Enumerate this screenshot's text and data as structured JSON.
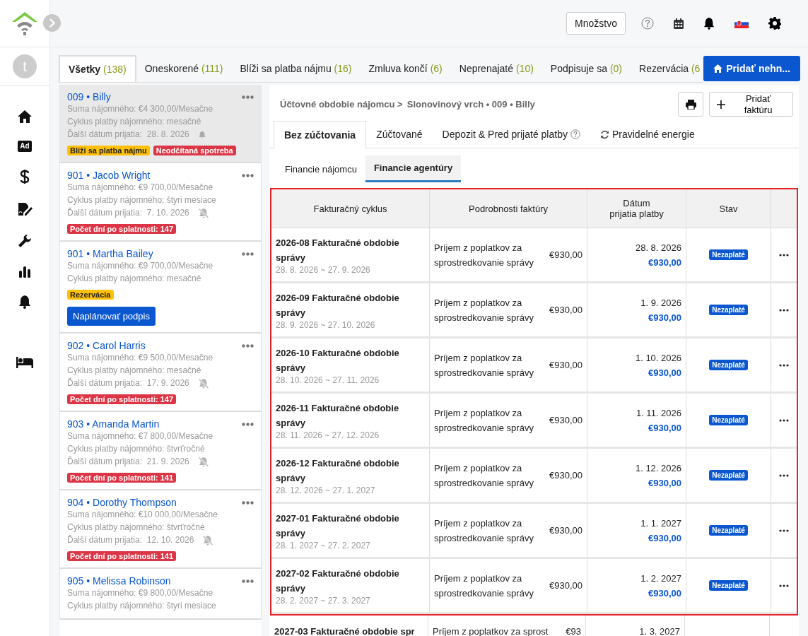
{
  "sidebar": {
    "avatar": "t",
    "nav": [
      {
        "kind": "home"
      },
      {
        "kind": "ad",
        "glyph": "Ad"
      },
      {
        "kind": "dollar"
      },
      {
        "kind": "sign"
      },
      {
        "kind": "wrench"
      },
      {
        "kind": "chart"
      },
      {
        "kind": "bell"
      },
      {
        "kind": "bed"
      }
    ]
  },
  "topbar": {
    "quantity_button": "Množstvo"
  },
  "tabs": [
    {
      "label": "Všetky",
      "count": "(138)",
      "selected": true
    },
    {
      "label": "Oneskorené",
      "count": "(111)",
      "selected": false
    },
    {
      "label": "Blíži sa platba nájmu",
      "count": "(16)",
      "selected": false
    },
    {
      "label": "Zmluva končí",
      "count": "(6)",
      "selected": false
    },
    {
      "label": "Neprenajaté",
      "count": "(10)",
      "selected": false
    },
    {
      "label": "Podpisuje sa",
      "count": "(0)",
      "selected": false
    },
    {
      "label": "Rezervácia",
      "count": "(6",
      "selected": false
    }
  ],
  "add_property_button": "Pridať nehn...",
  "tenants": [
    {
      "title": "009 • Billy",
      "rent": "Suma nájomného: €4 300,00/Mesačne",
      "cycle": "Cyklus platby nájomného: mesačné",
      "next_date": "Ďalší dátum prijatia:  28. 8. 2026",
      "reminder_muted": false,
      "selected": true,
      "badges": [
        {
          "text": "Blíži sa platba nájmu",
          "kind": "warning"
        },
        {
          "text": "Neodčítaná spotreba",
          "kind": "danger"
        }
      ]
    },
    {
      "title": "901 • Jacob Wright",
      "rent": "Suma nájomného: €9 700,00/Mesačne",
      "cycle": "Cyklus platby nájomného: štyri mesiace",
      "next_date": "Ďalší dátum prijatia:  7. 10. 2026",
      "reminder_muted": true,
      "selected": false,
      "badges": [
        {
          "text": "Počet dní po splatnosti: 147",
          "kind": "danger"
        }
      ]
    },
    {
      "title": "901 • Martha Bailey",
      "rent": "Suma nájomného: €9 700,00/Mesačne",
      "cycle": "Cyklus platby nájomného: mesačné",
      "selected": false,
      "badges": [
        {
          "text": "Rezervácia",
          "kind": "warning"
        }
      ],
      "action": "Naplánovať podpis"
    },
    {
      "title": "902 • Carol Harris",
      "rent": "Suma nájomného: €9 500,00/Mesačne",
      "cycle": "Cyklus platby nájomného: mesačné",
      "next_date": "Ďalší dátum prijatia:  17. 9. 2026",
      "reminder_muted": true,
      "selected": false,
      "badges": [
        {
          "text": "Počet dní po splatnosti: 147",
          "kind": "danger"
        }
      ]
    },
    {
      "title": "903 • Amanda Martin",
      "rent": "Suma nájomného: €7 800,00/Mesačne",
      "cycle": "Cyklus platby nájomného: štvrťročné",
      "next_date": "Ďalší dátum prijatia:  21. 9. 2026",
      "reminder_muted": true,
      "selected": false,
      "badges": [
        {
          "text": "Počet dní po splatnosti: 141",
          "kind": "danger"
        }
      ]
    },
    {
      "title": "904 • Dorothy Thompson",
      "rent": "Suma nájomného: €10 000,00/Mesačne",
      "cycle": "Cyklus platby nájomného: štvrťročné",
      "next_date": "Ďalší dátum prijatia:  12. 10. 2026",
      "reminder_muted": true,
      "selected": false,
      "badges": [
        {
          "text": "Počet dní po splatnosti: 141",
          "kind": "danger"
        }
      ]
    },
    {
      "title": "905 • Melissa Robinson",
      "rent": "Suma nájomného: €9 800,00/Mesačne",
      "cycle": "Cyklus platby nájomného: štyri mesiace",
      "selected": false
    }
  ],
  "detail": {
    "breadcrumb": [
      "Účtovné obdobie nájomcu >",
      "Slonovinový vrch • 009 • Billy"
    ],
    "add_invoice_button": "Pridať faktúru",
    "tabs": [
      {
        "label": "Bez zúčtovania",
        "kind": "plain",
        "selected": true
      },
      {
        "label": "Zúčtované",
        "kind": "plain",
        "selected": false
      },
      {
        "label": "Depozit & Pred prijaté platby",
        "kind": "help",
        "selected": false
      },
      {
        "label": "Pravidelné energie",
        "kind": "refresh",
        "selected": false
      }
    ],
    "subtabs": [
      {
        "label": "Financie nájomcu",
        "selected": false
      },
      {
        "label": "Financie agentúry",
        "selected": true
      }
    ],
    "table": {
      "columns": [
        "Fakturačný cyklus",
        "Podrobnosti faktúry",
        "Dátum prijatia platby",
        "Stav"
      ],
      "rows": [
        {
          "cycle": "2026-08 Fakturačné obdobie správy",
          "range": "28. 8. 2026 ~ 27. 9. 2026",
          "detail": "Príjem z poplatkov za sprostredkovanie správy",
          "amount": "€930,00",
          "date": "28. 8. 2026",
          "paid_amount": "€930,00",
          "status": "Nezaplaté",
          "highlighted": true
        },
        {
          "cycle": "2026-09 Fakturačné obdobie správy",
          "range": "28. 9. 2026 ~ 27. 10. 2026",
          "detail": "Príjem z poplatkov za sprostredkovanie správy",
          "amount": "€930,00",
          "date": "1. 9. 2026",
          "paid_amount": "€930,00",
          "status": "Nezaplaté",
          "highlighted": true
        },
        {
          "cycle": "2026-10 Fakturačné obdobie správy",
          "range": "28. 10. 2026 ~ 27. 11. 2026",
          "detail": "Príjem z poplatkov za sprostredkovanie správy",
          "amount": "€930,00",
          "date": "1. 10. 2026",
          "paid_amount": "€930,00",
          "status": "Nezaplaté",
          "highlighted": true
        },
        {
          "cycle": "2026-11 Fakturačné obdobie správy",
          "range": "28. 11. 2026 ~ 27. 12. 2026",
          "detail": "Príjem z poplatkov za sprostredkovanie správy",
          "amount": "€930,00",
          "date": "1. 11. 2026",
          "paid_amount": "€930,00",
          "status": "Nezaplaté",
          "highlighted": true
        },
        {
          "cycle": "2026-12 Fakturačné obdobie správy",
          "range": "28. 12. 2026 ~ 27. 1. 2027",
          "detail": "Príjem z poplatkov za sprostredkovanie správy",
          "amount": "€930,00",
          "date": "1. 12. 2026",
          "paid_amount": "€930,00",
          "status": "Nezaplaté",
          "highlighted": true
        },
        {
          "cycle": "2027-01 Fakturačné obdobie správy",
          "range": "28. 1. 2027 ~ 27. 2. 2027",
          "detail": "Príjem z poplatkov za sprostredkovanie správy",
          "amount": "€930,00",
          "date": "1. 1. 2027",
          "paid_amount": "€930,00",
          "status": "Nezaplaté",
          "highlighted": true
        },
        {
          "cycle": "2027-02 Fakturačné obdobie správy",
          "range": "28. 2. 2027 ~ 27. 3. 2027",
          "detail": "Príjem z poplatkov za sprostredkovanie správy",
          "amount": "€930,00",
          "date": "1. 2. 2027",
          "paid_amount": "€930,00",
          "status": "Nezaplaté",
          "highlighted": true
        },
        {
          "cycle": "2027-03 Fakturačné obdobie spr",
          "detail": "Príjem z poplatkov za sprost",
          "amount": "€93",
          "date": "1. 3. 2027",
          "highlighted": false
        }
      ]
    }
  }
}
